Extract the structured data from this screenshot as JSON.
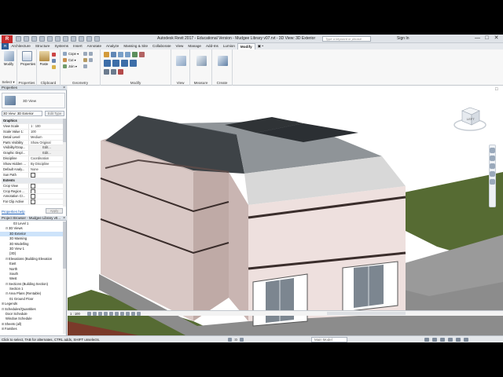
{
  "titlebar": {
    "app_badge": "R",
    "title": "Autodesk Revit 2017 - Educational Version -   Mudgee Library v07.rvt - 3D View: 3D Exterior",
    "search_placeholder": "Type a keyword or phrase",
    "sign_in": "Sign In",
    "minimize": "—",
    "maximize": "□",
    "close": "✕"
  },
  "tabs": [
    "Architecture",
    "Structure",
    "Systems",
    "Insert",
    "Annotate",
    "Analyze",
    "Massing & Site",
    "Collaborate",
    "View",
    "Manage",
    "Add-Ins",
    "Lumion",
    "Modify",
    "▣ •"
  ],
  "file_tab": "R",
  "active_tab_index": 12,
  "ribbon": {
    "select": {
      "button": "Modify",
      "title": "Select ▾"
    },
    "properties": {
      "button": "Properties",
      "title": "Properties"
    },
    "clipboard": {
      "button": "Paste",
      "title": "Clipboard"
    },
    "geometry": {
      "items": [
        "Cope ▾",
        "Cut ▾",
        "Join ▾"
      ],
      "title": "Geometry"
    },
    "modify": {
      "title": "Modify"
    },
    "view": {
      "title": "View"
    },
    "measure": {
      "title": "Measure"
    },
    "create": {
      "title": "Create"
    }
  },
  "properties": {
    "header": "Properties",
    "type_name": "3D View",
    "instance": "3D View: 3D Exterior",
    "edit_type": "Edit Type",
    "rows": [
      {
        "key": "Graphics",
        "group": true
      },
      {
        "key": "View Scale",
        "value": "1 : 100"
      },
      {
        "key": "Scale Value 1:",
        "value": "100"
      },
      {
        "key": "Detail Level",
        "value": "Medium"
      },
      {
        "key": "Parts Visibility",
        "value": "Show Original"
      },
      {
        "key": "Visibility/Grap...",
        "value": "Edit...",
        "button": true
      },
      {
        "key": "Graphic Displ...",
        "value": "Edit...",
        "button": true
      },
      {
        "key": "Discipline",
        "value": "Coordination"
      },
      {
        "key": "Show Hidden ...",
        "value": "By Discipline"
      },
      {
        "key": "Default Analy...",
        "value": "None"
      },
      {
        "key": "Sun Path",
        "value": "",
        "check": true
      },
      {
        "key": "Extents",
        "group": true
      },
      {
        "key": "Crop View",
        "value": "",
        "check": true
      },
      {
        "key": "Crop Region ...",
        "value": "",
        "check": true
      },
      {
        "key": "Annotation Cr...",
        "value": "",
        "check": true
      },
      {
        "key": "Far Clip Active",
        "value": "",
        "check": true
      }
    ],
    "help_link": "Properties help",
    "apply": "Apply"
  },
  "browser": {
    "header": "Project Browser - Mudgee Library v0...",
    "nodes": [
      {
        "depth": 3,
        "label": "03 Level 1"
      },
      {
        "depth": 1,
        "toggle": "⊟",
        "label": "3D Views"
      },
      {
        "depth": 2,
        "label": "3D Exterior",
        "selected": true
      },
      {
        "depth": 2,
        "label": "3D Massing"
      },
      {
        "depth": 2,
        "label": "3D Modelling"
      },
      {
        "depth": 2,
        "label": "3D View 1"
      },
      {
        "depth": 2,
        "label": "{3D}"
      },
      {
        "depth": 1,
        "toggle": "⊟",
        "label": "Elevations (Building Elevation"
      },
      {
        "depth": 2,
        "label": "East"
      },
      {
        "depth": 2,
        "label": "North"
      },
      {
        "depth": 2,
        "label": "South"
      },
      {
        "depth": 2,
        "label": "West"
      },
      {
        "depth": 1,
        "toggle": "⊟",
        "label": "Sections (Building Section)"
      },
      {
        "depth": 2,
        "label": "Section 1"
      },
      {
        "depth": 1,
        "toggle": "⊟",
        "label": "Area Plans (Rentable)"
      },
      {
        "depth": 2,
        "label": "01 Ground Floor"
      },
      {
        "depth": 0,
        "toggle": "⊞",
        "label": "Legends"
      },
      {
        "depth": 0,
        "toggle": "⊟",
        "label": "Schedules/Quantities"
      },
      {
        "depth": 1,
        "label": "Door Schedule"
      },
      {
        "depth": 1,
        "label": "Window Schedule"
      },
      {
        "depth": 0,
        "toggle": "⊞",
        "label": "Sheets (all)"
      },
      {
        "depth": 0,
        "toggle": "⊞",
        "label": "Families"
      }
    ]
  },
  "viewport": {
    "viewcube_label": "LEFT",
    "scale": "1 : 100",
    "close": "□"
  },
  "statusbar": {
    "hint": "Click to select, TAB for alternates, CTRL adds, SHIFT unselects.",
    "model": "Main Model",
    "zero": ":0"
  }
}
